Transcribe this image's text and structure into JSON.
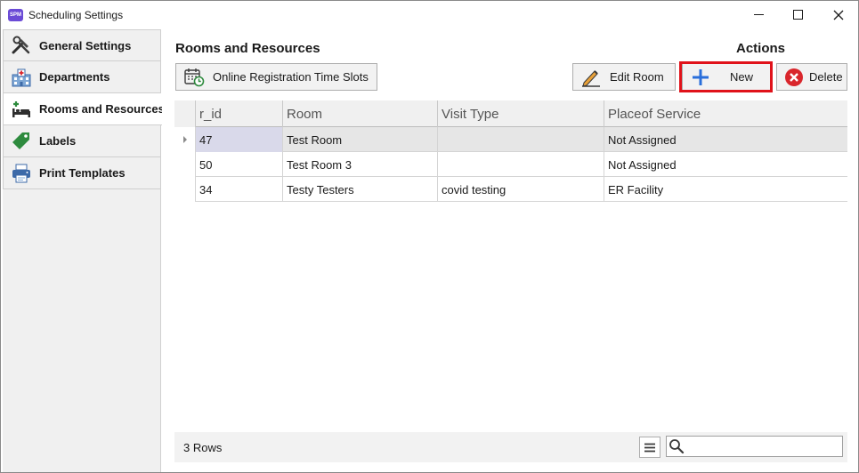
{
  "window": {
    "title": "Scheduling Settings",
    "app_icon_text": "SPM"
  },
  "sidebar": {
    "items": [
      {
        "label": "General Settings",
        "icon": "tools-icon"
      },
      {
        "label": "Departments",
        "icon": "hospital-icon"
      },
      {
        "label": "Rooms and Resources",
        "icon": "bed-icon",
        "active": true
      },
      {
        "label": "Labels",
        "icon": "tag-icon"
      },
      {
        "label": "Print Templates",
        "icon": "printer-icon"
      }
    ]
  },
  "main": {
    "section_title": "Rooms and Resources",
    "actions_title": "Actions",
    "buttons": {
      "slots": "Online Registration Time Slots",
      "edit": "Edit Room",
      "new": "New",
      "delete": "Delete"
    },
    "grid": {
      "columns": [
        "r_id",
        "Room",
        "Visit Type",
        "Placeof Service"
      ],
      "rows": [
        {
          "r_id": "47",
          "room": "Test Room",
          "visit_type": "",
          "place": "Not Assigned"
        },
        {
          "r_id": "50",
          "room": "Test Room 3",
          "visit_type": "",
          "place": "Not Assigned"
        },
        {
          "r_id": "34",
          "room": "Testy Testers",
          "visit_type": "covid testing",
          "place": "ER Facility"
        }
      ]
    },
    "footer": {
      "rows_count": "3 Rows",
      "search_placeholder": ""
    }
  },
  "colors": {
    "highlight": "#e0121a",
    "new_plus": "#2a6fdb",
    "delete_red": "#d9262c",
    "app_icon": "#6b4bd6"
  }
}
